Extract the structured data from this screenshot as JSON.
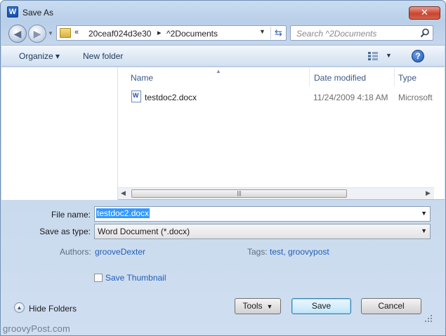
{
  "window": {
    "title": "Save As",
    "app_icon": "W",
    "close_glyph": "✕"
  },
  "nav": {
    "back_glyph": "◀",
    "forward_glyph": "▶",
    "address_overflow": "«",
    "address_segments": [
      "20ceaf024d3e30",
      "^2Documents"
    ],
    "address_sep": "▸",
    "search_placeholder": "Search ^2Documents"
  },
  "toolbar": {
    "organize_label": "Organize ▾",
    "new_folder_label": "New folder",
    "help_glyph": "?"
  },
  "columns": {
    "name": "Name",
    "date_modified": "Date modified",
    "type": "Type"
  },
  "files": [
    {
      "name": "testdoc2.docx",
      "date": "11/24/2009 4:18 AM",
      "type": "Microsoft",
      "icon_letter": "W"
    }
  ],
  "form": {
    "file_name_label": "File name:",
    "file_name_value": "testdoc2.docx",
    "save_as_type_label": "Save as type:",
    "save_as_type_value": "Word Document (*.docx)",
    "authors_label": "Authors:",
    "authors_value": "grooveDexter",
    "tags_label": "Tags:",
    "tags_value": "test, groovypost",
    "save_thumbnail_label": "Save Thumbnail",
    "save_thumbnail_checked": false
  },
  "footer": {
    "hide_folders_label": "Hide Folders",
    "tools_label": "Tools",
    "save_label": "Save",
    "cancel_label": "Cancel"
  },
  "watermark": "groovyPost.com",
  "colors": {
    "accent": "#3399ff",
    "link": "#1f5fb8",
    "close": "#c9452f"
  }
}
